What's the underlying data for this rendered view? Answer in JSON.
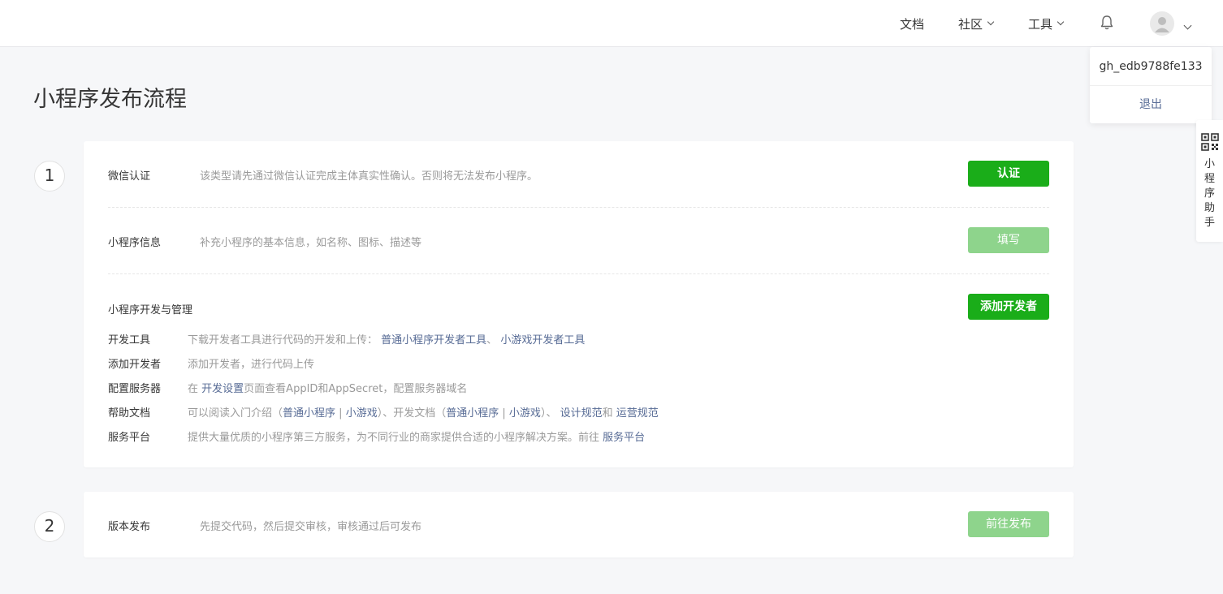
{
  "nav": {
    "docs": "文档",
    "community": "社区",
    "tools": "工具"
  },
  "account_menu": {
    "account_id": "gh_edb9788fe133",
    "logout": "退出"
  },
  "helper": {
    "label": "小程序助手"
  },
  "page_title": "小程序发布流程",
  "steps": [
    {
      "number": "1",
      "rows": [
        {
          "label": "微信认证",
          "desc": "该类型请先通过微信认证完成主体真实性确认。否则将无法发布小程序。",
          "button": "认证",
          "button_state": "enabled"
        },
        {
          "label": "小程序信息",
          "desc": "补充小程序的基本信息，如名称、图标、描述等",
          "button": "填写",
          "button_state": "disabled"
        }
      ],
      "dev": {
        "title": "小程序开发与管理",
        "button": "添加开发者",
        "items": {
          "tools": {
            "label": "开发工具",
            "text": "下载开发者工具进行代码的开发和上传：",
            "link1": "普通小程序开发者工具",
            "sep": "、",
            "link2": "小游戏开发者工具"
          },
          "add": {
            "label": "添加开发者",
            "text": "添加开发者，进行代码上传"
          },
          "server": {
            "label": "配置服务器",
            "pre": "在",
            "link": "开发设置",
            "text": "页面查看AppID和AppSecret，配置服务器域名"
          },
          "help": {
            "label": "帮助文档",
            "t1": "可以阅读入门介绍（",
            "l1": "普通小程序",
            "bar1": "|",
            "l2": "小游戏",
            "t2": "）、开发文档（",
            "l3": "普通小程序",
            "bar2": "|",
            "l4": "小游戏",
            "t3": "）、",
            "l5": "设计规范",
            "t4": "和",
            "l6": "运营规范"
          },
          "service": {
            "label": "服务平台",
            "text": "提供大量优质的小程序第三方服务，为不同行业的商家提供合适的小程序解决方案。前往",
            "link": "服务平台"
          }
        }
      }
    },
    {
      "number": "2",
      "rows": [
        {
          "label": "版本发布",
          "desc": "先提交代码，然后提交审核，审核通过后可发布",
          "button": "前往发布",
          "button_state": "disabled"
        }
      ]
    }
  ],
  "colors": {
    "primary": "#1aad19",
    "primary_disabled": "#8ed48c",
    "link": "#576b95"
  }
}
